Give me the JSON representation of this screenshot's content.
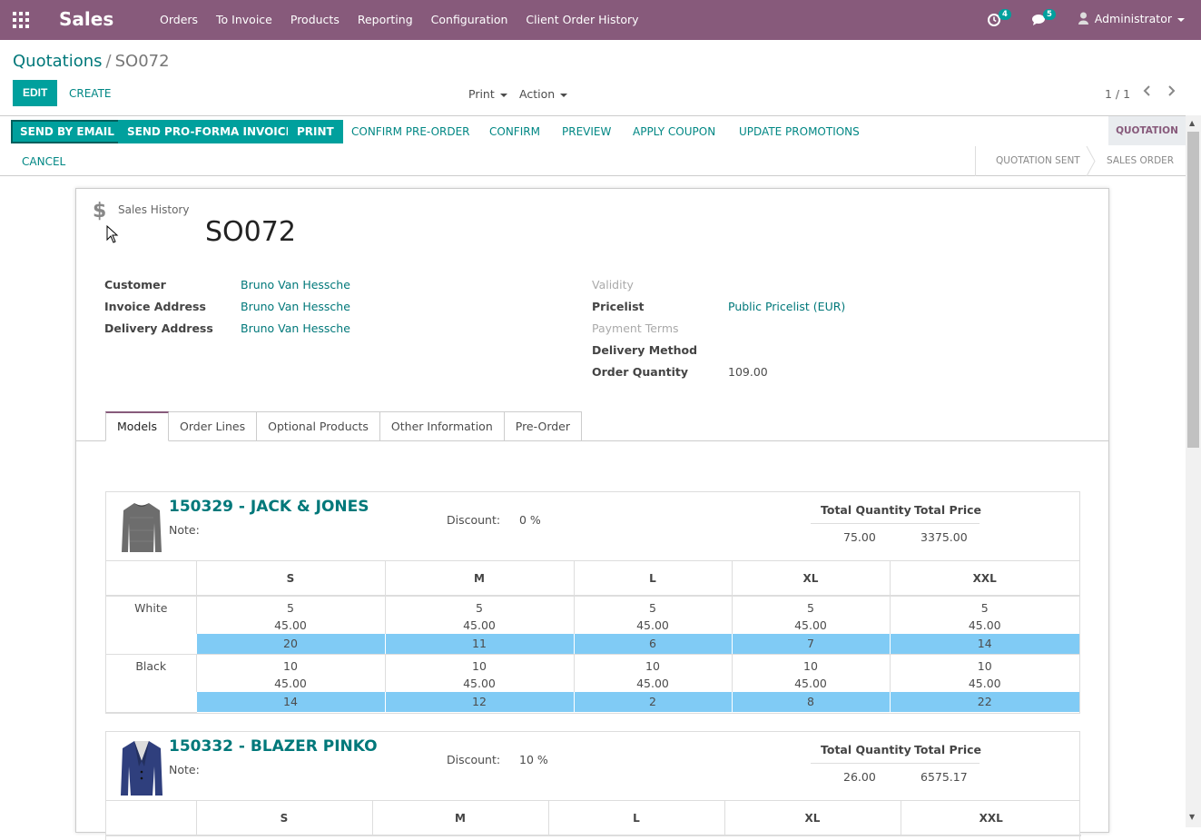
{
  "navbar": {
    "app_name": "Sales",
    "menu": [
      "Orders",
      "To Invoice",
      "Products",
      "Reporting",
      "Configuration",
      "Client Order History"
    ],
    "activity_count": "4",
    "messages_count": "5",
    "user": "Administrator",
    "color": "#875a7b"
  },
  "breadcrumb": {
    "parent": "Quotations",
    "current": "SO072"
  },
  "control": {
    "edit": "EDIT",
    "create": "CREATE",
    "print": "Print",
    "action": "Action",
    "pager": "1 / 1"
  },
  "statusbar": {
    "buttons": [
      "SEND BY EMAIL",
      "SEND PRO-FORMA INVOICE",
      "PRINT",
      "CONFIRM PRE-ORDER",
      "CONFIRM",
      "PREVIEW",
      "APPLY COUPON",
      "UPDATE PROMOTIONS"
    ],
    "cancel": "CANCEL",
    "stages": [
      "QUOTATION",
      "QUOTATION SENT",
      "SALES ORDER"
    ],
    "active_stage": "QUOTATION"
  },
  "sheet": {
    "smart_button": "Sales History",
    "title": "SO072",
    "left_fields": [
      {
        "label": "Customer",
        "value": "Bruno Van Hessche"
      },
      {
        "label": "Invoice Address",
        "value": "Bruno Van Hessche"
      },
      {
        "label": "Delivery Address",
        "value": "Bruno Van Hessche"
      }
    ],
    "right_fields": [
      {
        "label": "Validity",
        "value": ""
      },
      {
        "label": "Pricelist",
        "value": "Public Pricelist (EUR)"
      },
      {
        "label": "Payment Terms",
        "value": ""
      },
      {
        "label": "Delivery Method",
        "value": ""
      },
      {
        "label": "Order Quantity",
        "value": "109.00"
      }
    ],
    "tabs": [
      "Models",
      "Order Lines",
      "Optional Products",
      "Other Information",
      "Pre-Order"
    ]
  },
  "models": [
    {
      "title": "150329 - JACK & JONES",
      "note_label": "Note:",
      "discount_label": "Discount:",
      "discount": "0 %",
      "total_qty_label": "Total Quantity",
      "total_price_label": "Total Price",
      "total_qty": "75.00",
      "total_price": "3375.00",
      "sizes": [
        "S",
        "M",
        "L",
        "XL",
        "XXL"
      ],
      "rows": [
        {
          "color": "White",
          "qty": [
            "5",
            "5",
            "5",
            "5",
            "5"
          ],
          "price": [
            "45.00",
            "45.00",
            "45.00",
            "45.00",
            "45.00"
          ],
          "stock": [
            "20",
            "11",
            "6",
            "7",
            "14"
          ]
        },
        {
          "color": "Black",
          "qty": [
            "10",
            "10",
            "10",
            "10",
            "10"
          ],
          "price": [
            "45.00",
            "45.00",
            "45.00",
            "45.00",
            "45.00"
          ],
          "stock": [
            "14",
            "12",
            "2",
            "8",
            "22"
          ]
        }
      ]
    },
    {
      "title": "150332 - BLAZER PINKO",
      "note_label": "Note:",
      "discount_label": "Discount:",
      "discount": "10 %",
      "total_qty_label": "Total Quantity",
      "total_price_label": "Total Price",
      "total_qty": "26.00",
      "total_price": "6575.17",
      "sizes": [
        "S",
        "M",
        "L",
        "XL",
        "XXL"
      ]
    }
  ]
}
